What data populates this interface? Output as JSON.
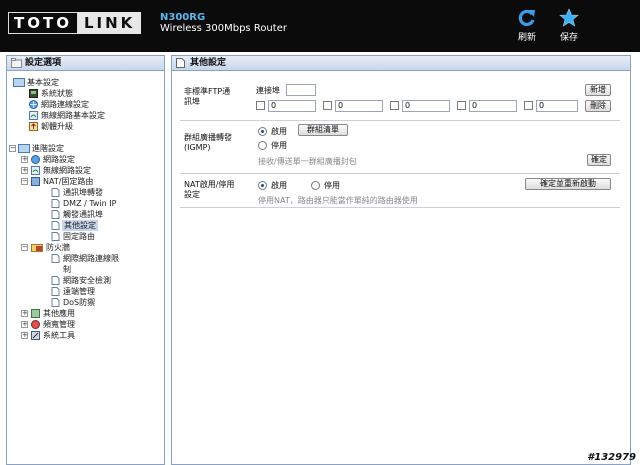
{
  "header": {
    "logo_left": "TOTO",
    "logo_right": "LINK",
    "model": "N300RG",
    "model_desc": "Wireless 300Mbps Router",
    "refresh_label": "刷新",
    "save_label": "保存"
  },
  "sidebar": {
    "title": "設定選項",
    "basic": {
      "label": "基本設定",
      "items": [
        "系統狀態",
        "網路連線設定",
        "無線網路基本設定",
        "韌體升級"
      ]
    },
    "advanced": {
      "label": "進階設定",
      "network": "網路設定",
      "wireless": "無線網路設定",
      "nat": {
        "label": "NAT/固定路由",
        "items": [
          "通訊埠轉發",
          "DMZ / Twin IP",
          "觸發通訊埠",
          "其他設定",
          "固定路由"
        ]
      },
      "firewall": {
        "label": "防火牆",
        "items": [
          "網際網路連線限",
          "制",
          "網路安全檢測",
          "遠端管理",
          "DoS防禦"
        ]
      },
      "other_apps": "其他應用",
      "bandwidth": "頻寬管理",
      "system_tools": "系統工具"
    }
  },
  "main": {
    "title": "其他設定",
    "ftp": {
      "label_line1": "非標準FTP通",
      "label_line2": "訊埠",
      "port_label": "連接埠",
      "port_value": "",
      "add_button": "新增",
      "delete_button": "刪除",
      "entries": [
        "0",
        "0",
        "0",
        "0",
        "0"
      ]
    },
    "igmp": {
      "label_line1": "群組廣播轉發",
      "label_line2": "(IGMP)",
      "enable_label": "啟用",
      "disable_label": "停用",
      "group_list_button": "群組清單",
      "hint": "接收/傳送單一群組廣播封包",
      "confirm_button": "確定"
    },
    "nat": {
      "label_line1": "NAT啟用/停用",
      "label_line2": "設定",
      "enable_label": "啟用",
      "disable_label": "停用",
      "restart_button": "確定並重新啟動",
      "hint": "停用NAT，路由器只能當作單純的路由器使用"
    }
  },
  "footer_id": "#132979"
}
